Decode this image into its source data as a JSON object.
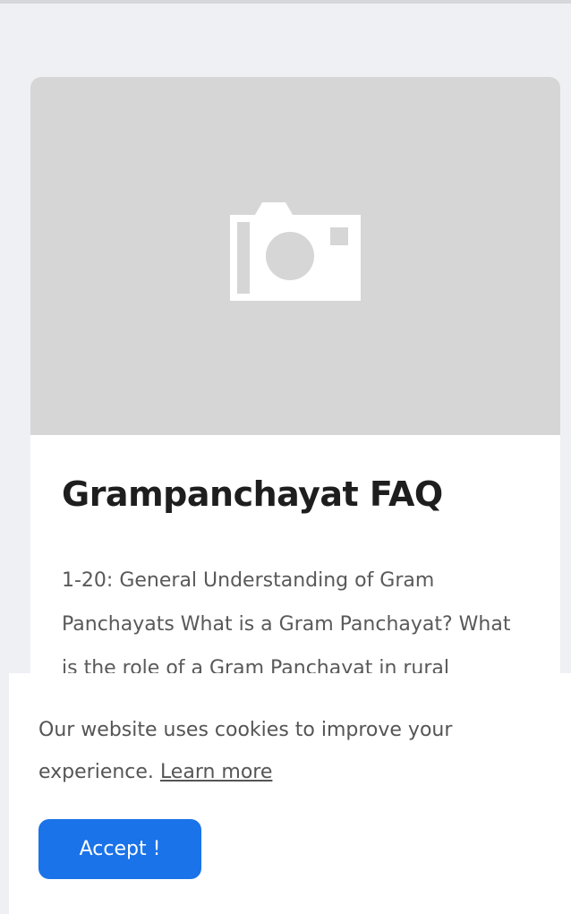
{
  "card": {
    "image_icon": "camera-icon",
    "title": "Grampanchayat FAQ",
    "excerpt": "1-20: General Understanding of Gram Panchayats What is a Gram Panchayat? What is the role of a Gram Panchayat in rural governance?"
  },
  "cookie_banner": {
    "message": "Our website uses cookies to improve your experience.",
    "learn_more_label": "Learn more",
    "accept_label": "Accept !"
  },
  "colors": {
    "page_background": "#eff0f4",
    "image_placeholder": "#d6d6d6",
    "accent": "#1a73e8"
  }
}
